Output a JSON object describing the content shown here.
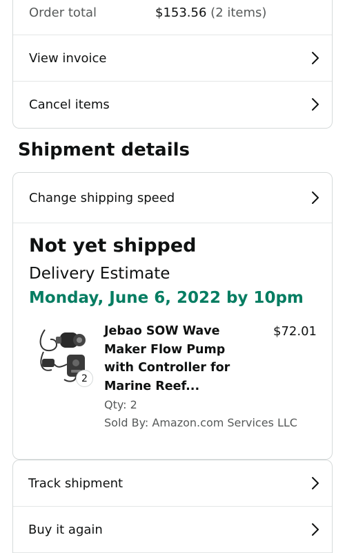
{
  "order": {
    "total_label": "Order total",
    "total_value": "$153.56",
    "total_items": "(2 items)",
    "actions": [
      {
        "label": "View invoice"
      },
      {
        "label": "Cancel items"
      }
    ]
  },
  "shipment": {
    "section_title": "Shipment details",
    "change_speed_label": "Change shipping speed",
    "status": "Not yet shipped",
    "estimate_label": "Delivery Estimate",
    "estimate_date": "Monday, June 6, 2022 by 10pm",
    "item": {
      "title": "Jebao SOW Wave Maker Flow Pump with Controller for Marine Reef...",
      "price": "$72.01",
      "qty_badge": "2",
      "qty_text": "Qty: 2",
      "seller": "Sold By: Amazon.com Services LLC"
    },
    "actions": [
      {
        "label": "Track shipment"
      },
      {
        "label": "Buy it again"
      }
    ]
  },
  "colors": {
    "estimate_green": "#067d62",
    "border": "#d5d9d9",
    "secondary_text": "#565959"
  },
  "icons": {
    "row_chevron": "chevron-right-icon",
    "product_image": "wave-maker-pump-image"
  }
}
